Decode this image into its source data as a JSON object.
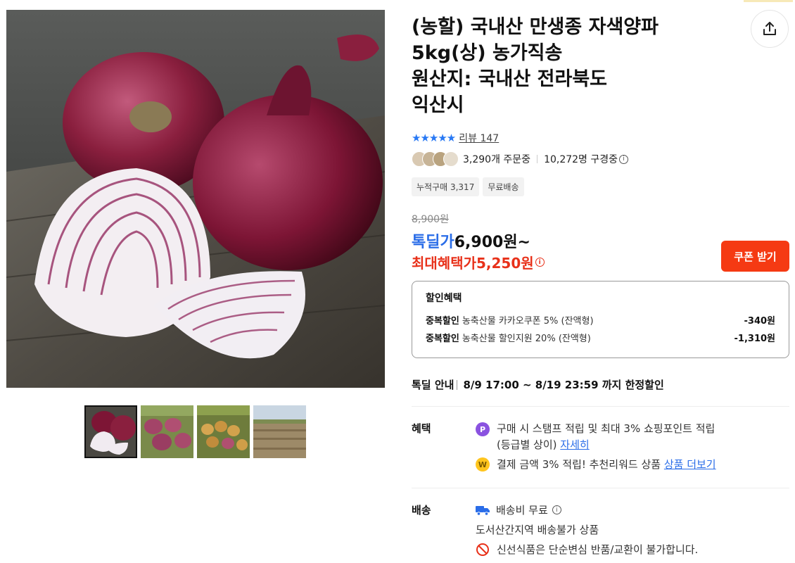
{
  "product": {
    "title": "(농할) 국내산 만생종 자색양파\n5kg(상) 농가직송\n원산지: 국내산 전라북도\n익산시",
    "stars": "★★★★★",
    "review_label": "리뷰 147",
    "order_count": "3,290개 주문중",
    "viewer_count": "10,272명 구경중",
    "info_glyph": "i",
    "chips": [
      "누적구매 3,317",
      "무료배송"
    ],
    "original_price": "8,900원",
    "sale_tag": "톡딜가",
    "sale_price": "6,900원~",
    "max_benefit_label": "최대혜택가",
    "max_benefit_price": "5,250원",
    "coupon_button": "쿠폰 받기"
  },
  "discount": {
    "heading": "할인혜택",
    "rows": [
      {
        "type": "중복할인",
        "desc": "농축산물 카카오쿠폰 5% (잔액형)",
        "amount": "-340원"
      },
      {
        "type": "중복할인",
        "desc": "농축산물 할인지원 20% (잔액형)",
        "amount": "-1,310원"
      }
    ]
  },
  "special": {
    "label": "톡딜 안내",
    "text": "8/9 17:00 ~ 8/19 23:59 까지 한정할인"
  },
  "benefit": {
    "label": "혜택",
    "point_badge": "P",
    "line1": "구매 시 스탬프 적립 및 최대 3% 쇼핑포인트 적립",
    "line1b": "(등급별 상이)",
    "line1_link": "자세히",
    "reward_badge": "W",
    "line2": "결제 금액 3% 적립! 추천리워드 상품",
    "line2_link": "상품 더보기"
  },
  "shipping": {
    "label": "배송",
    "fee": "배송비 무료",
    "note": "도서산간지역 배송불가 상품",
    "warning": "신선식품은 단순변심 반품/교환이 불가합니다."
  },
  "icons": {
    "share": "share-icon",
    "truck": "truck-icon",
    "prohibited": "prohibited-icon"
  },
  "colors": {
    "accent_blue": "#2a6de8",
    "accent_red": "#e8311a",
    "coupon_bg": "#f53a13",
    "star_blue": "#2778f4"
  }
}
